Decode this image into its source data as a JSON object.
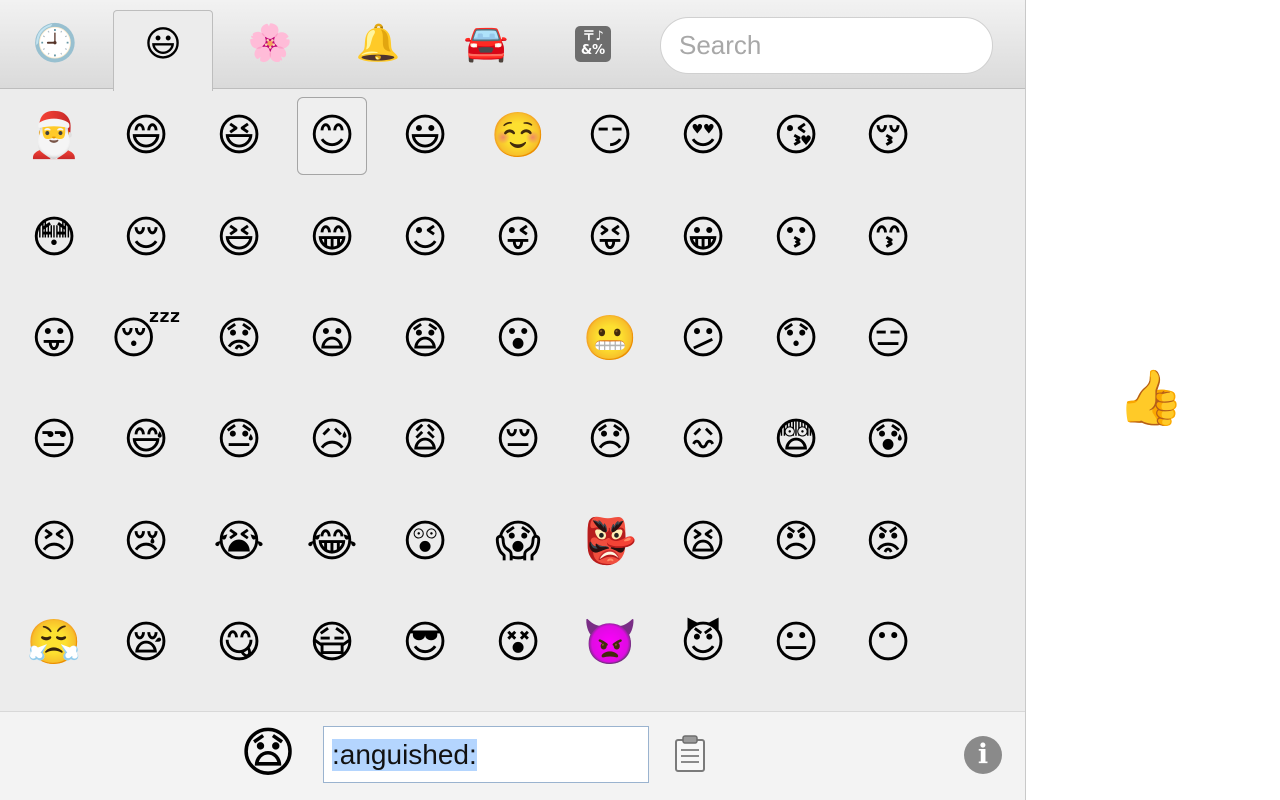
{
  "tabs": [
    {
      "id": "recent",
      "icon": "clock-icon",
      "glyph": "🕘",
      "active": false
    },
    {
      "id": "people",
      "icon": "smiley-icon",
      "glyph": "😃",
      "active": true
    },
    {
      "id": "nature",
      "icon": "flower-icon",
      "glyph": "🌸",
      "active": false
    },
    {
      "id": "objects",
      "icon": "bell-icon",
      "glyph": "🔔",
      "active": false
    },
    {
      "id": "places",
      "icon": "car-icon",
      "glyph": "🚘",
      "active": false
    },
    {
      "id": "symbols",
      "icon": "symbols-icon",
      "glyph": "〒♪\n&%",
      "active": false
    }
  ],
  "search": {
    "placeholder": "Search",
    "value": ""
  },
  "emoji_grid": [
    [
      "🎅",
      "😄",
      "😆",
      "😊",
      "😃",
      "☺️",
      "😏",
      "😍",
      "😘",
      "😚"
    ],
    [
      "😳",
      "😌",
      "😆",
      "😁",
      "😉",
      "😜",
      "😝",
      "😀",
      "😗",
      "😙"
    ],
    [
      "😛",
      "😴",
      "😟",
      "😦",
      "😧",
      "😮",
      "😬",
      "😕",
      "😯",
      "😑"
    ],
    [
      "😒",
      "😅",
      "😓",
      "😥",
      "😩",
      "😔",
      "😞",
      "😖",
      "😨",
      "😰"
    ],
    [
      "😣",
      "😢",
      "😭",
      "😂",
      "😲",
      "😱",
      "👺",
      "😫",
      "😠",
      "😡"
    ],
    [
      "😤",
      "😪",
      "😋",
      "😷",
      "😎",
      "😵",
      "👿",
      "😈",
      "😐",
      "😶"
    ]
  ],
  "selected_cell": {
    "row": 0,
    "col": 3
  },
  "footer": {
    "preview_glyph": "😧",
    "name_value": ":anguished:",
    "clipboard_icon": "clipboard-icon",
    "info_glyph": "i"
  },
  "outside": {
    "thumb_glyph": "👍"
  }
}
